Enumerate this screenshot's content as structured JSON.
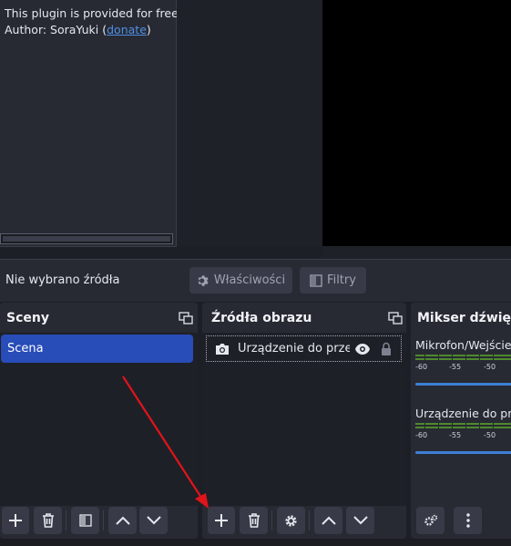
{
  "plugin_panel": {
    "line1": "This plugin is provided for free.",
    "line2_prefix": "Author: SoraYuki (",
    "donate_link": "donate",
    "line2_suffix": ")"
  },
  "source_toolbar": {
    "no_source_label": "Nie wybrano źródła",
    "properties_label": "Właściwości",
    "filters_label": "Filtry"
  },
  "scenes_dock": {
    "title": "Sceny",
    "items": [
      "Scena"
    ]
  },
  "sources_dock": {
    "title": "Źródła obrazu",
    "items": [
      {
        "name": "Urządzenie do przeci",
        "icon": "camera-icon"
      }
    ]
  },
  "mixer_dock": {
    "title": "Mikser dźwięk",
    "channels": [
      {
        "name": "Mikrofon/Wejście",
        "ticks": [
          "-60",
          "-55",
          "-50"
        ]
      },
      {
        "name": "Urządzenie do prz",
        "ticks": [
          "-60",
          "-55",
          "-50"
        ]
      }
    ]
  },
  "colors": {
    "accent_selected": "#284cb8",
    "panel_bg": "#272a33",
    "annotation_arrow": "#e0141a",
    "meter_green": "#4e8a2c",
    "volume_blue": "#3d7fd6"
  }
}
